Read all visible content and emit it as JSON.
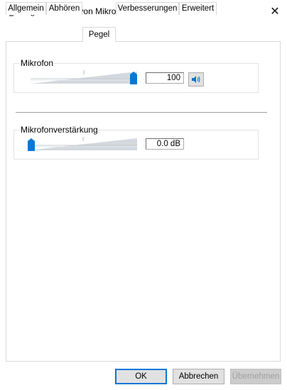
{
  "window": {
    "title": "Eigenschaften von Mikrofon",
    "close_glyph": "✕"
  },
  "tabs": [
    {
      "label": "Allgemein",
      "active": false
    },
    {
      "label": "Abhören",
      "active": false
    },
    {
      "label": "Pegel",
      "active": true
    },
    {
      "label": "Verbesserungen",
      "active": false
    },
    {
      "label": "Erweitert",
      "active": false
    }
  ],
  "microphone": {
    "label": "Mikrofon",
    "value": "100",
    "level_fraction": 1.0,
    "speaker_icon": "speaker-volume-icon"
  },
  "boost": {
    "label": "Mikrofonverstärkung",
    "value": "0.0 dB",
    "level_fraction": 0.0
  },
  "buttons": {
    "ok": "OK",
    "cancel": "Abbrechen",
    "apply": "Übernehmen"
  },
  "colors": {
    "accent": "#0078d7",
    "track": "#d3d9de"
  }
}
